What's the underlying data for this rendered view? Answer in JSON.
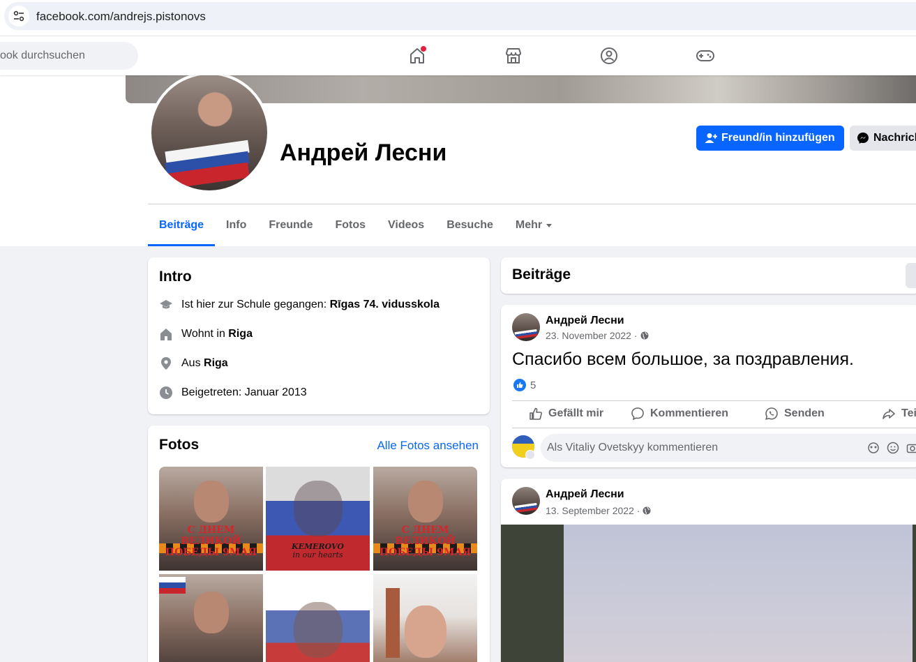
{
  "browser": {
    "url": "facebook.com/andrejs.pistonovs"
  },
  "nav": {
    "search_placeholder": "ook durchsuchen",
    "icons": [
      "home-icon",
      "marketplace-icon",
      "groups-icon",
      "gaming-icon"
    ]
  },
  "profile": {
    "name": "Андрей Лесни",
    "add_friend_label": "Freund/in hinzufügen",
    "message_label": "Nachricht"
  },
  "tabs": [
    {
      "label": "Beiträge"
    },
    {
      "label": "Info"
    },
    {
      "label": "Freunde"
    },
    {
      "label": "Fotos"
    },
    {
      "label": "Videos"
    },
    {
      "label": "Besuche"
    },
    {
      "label": "Mehr"
    }
  ],
  "intro": {
    "title": "Intro",
    "school_prefix": "Ist hier zur Schule gegangen: ",
    "school_value": "Rīgas 74. vidusskola",
    "lives_prefix": "Wohnt in ",
    "lives_value": "Riga",
    "from_prefix": "Aus ",
    "from_value": "Riga",
    "joined": "Beigetreten: Januar 2013"
  },
  "photos": {
    "title": "Fotos",
    "see_all": "Alle Fotos ansehen",
    "captions": {
      "victory": "С ДНЕМ ВЕЛИКОЙ ПОБЕДЫ 9МАЯ",
      "kemerovo_1": "KEMEROVO",
      "kemerovo_2": "in our hearts"
    }
  },
  "posts_header": {
    "title": "Beiträge"
  },
  "posts": [
    {
      "author": "Андрей Лесни",
      "date": "23. November 2022 ·",
      "text": "Спасибо всем большое, за поздравления.",
      "likes": "5",
      "actions": {
        "like": "Gefällt mir",
        "comment": "Kommentieren",
        "send": "Senden",
        "share": "Teilen"
      },
      "comment_placeholder": "Als Vitaliy Ovetskyy kommentieren"
    },
    {
      "author": "Андрей Лесни",
      "date": "13. September 2022 ·"
    }
  ],
  "colors": {
    "accent": "#0866ff",
    "background": "#f0f2f5",
    "secondary_text": "#65676b"
  }
}
